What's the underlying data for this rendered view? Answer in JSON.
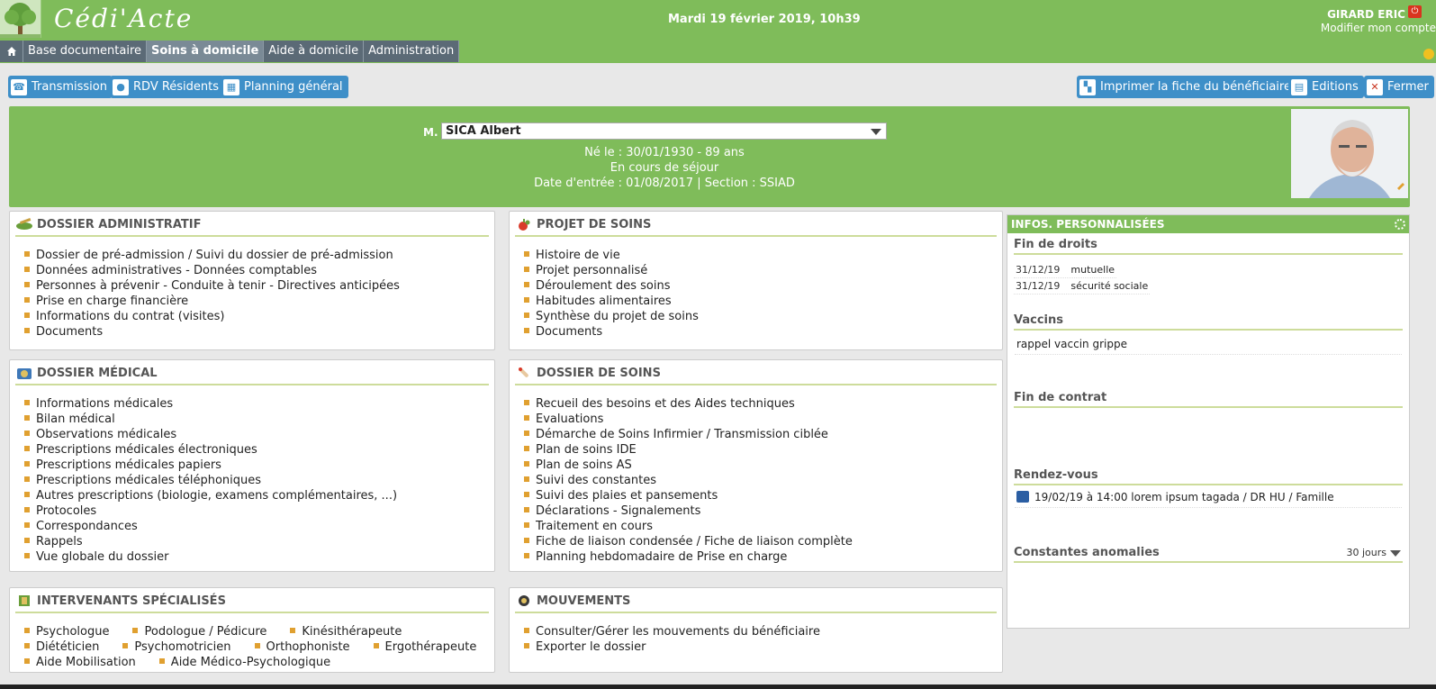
{
  "header": {
    "app_title": "Cédi'Acte",
    "date": "Mardi 19 février 2019, 10h39",
    "user_name": "GIRARD ERIC",
    "account_link": "Modifier mon compte"
  },
  "nav": {
    "tabs": [
      {
        "label": "Base documentaire"
      },
      {
        "label": "Soins à domicile",
        "active": true
      },
      {
        "label": "Aide à domicile"
      },
      {
        "label": "Administration"
      }
    ]
  },
  "toolbar": {
    "transmission": "Transmission",
    "rdv": "RDV Résidents",
    "planning": "Planning général",
    "print": "Imprimer la fiche du bénéficiaire",
    "editions": "Editions",
    "close": "Fermer"
  },
  "patient": {
    "civility": "M.",
    "name": "SICA Albert",
    "birth": "Né le : 30/01/1930 - 89 ans",
    "status": "En cours de séjour",
    "entry": "Date d'entrée : 01/08/2017 | Section : SSIAD"
  },
  "panels": {
    "admin": {
      "title": "DOSSIER ADMINISTRATIF",
      "items": [
        "Dossier de pré-admission / Suivi du dossier de pré-admission",
        "Données administratives - Données comptables",
        "Personnes à prévenir - Conduite à tenir - Directives anticipées",
        "Prise en charge financière",
        "Informations du contrat (visites)",
        "Documents"
      ]
    },
    "projet": {
      "title": "PROJET DE SOINS",
      "items": [
        "Histoire de vie",
        "Projet personnalisé",
        "Déroulement des soins",
        "Habitudes alimentaires",
        "Synthèse du projet de soins",
        "Documents"
      ]
    },
    "medical": {
      "title": "DOSSIER MÉDICAL",
      "items": [
        "Informations médicales",
        "Bilan médical",
        "Observations médicales",
        "Prescriptions médicales électroniques",
        "Prescriptions médicales papiers",
        "Prescriptions médicales téléphoniques",
        "Autres prescriptions (biologie, examens complémentaires, ...)",
        "Protocoles",
        "Correspondances",
        "Rappels",
        "Vue globale du dossier"
      ]
    },
    "soins": {
      "title": "DOSSIER DE SOINS",
      "items": [
        "Recueil des besoins et des Aides techniques",
        "Evaluations",
        "Démarche de Soins Infirmier / Transmission ciblée",
        "Plan de soins IDE",
        "Plan de soins AS",
        "Suivi des constantes",
        "Suivi des plaies et pansements",
        "Déclarations - Signalements",
        "Traitement en cours",
        "Fiche de liaison condensée / Fiche de liaison complète",
        "Planning hebdomadaire de Prise en charge"
      ]
    },
    "intervenants": {
      "title": "INTERVENANTS SPÉCIALISÉS",
      "items": [
        "Psychologue",
        "Podologue / Pédicure",
        "Kinésithérapeute",
        "Diététicien",
        "Psychomotricien",
        "Orthophoniste",
        "Ergothérapeute",
        "Aide Mobilisation",
        "Aide Médico-Psychologique"
      ]
    },
    "mouvements": {
      "title": "MOUVEMENTS",
      "items": [
        "Consulter/Gérer les mouvements du bénéficiaire",
        "Exporter le dossier"
      ]
    }
  },
  "infos": {
    "title": "INFOS. PERSONNALISÉES",
    "fin_droits": {
      "title": "Fin de droits",
      "rows": [
        {
          "date": "31/12/19",
          "label": "mutuelle"
        },
        {
          "date": "31/12/19",
          "label": "sécurité sociale"
        }
      ]
    },
    "vaccins": {
      "title": "Vaccins",
      "text": "rappel vaccin grippe"
    },
    "fin_contrat": {
      "title": "Fin de contrat"
    },
    "rdv": {
      "title": "Rendez-vous",
      "text": "19/02/19 à 14:00 lorem ipsum tagada / DR HU / Famille"
    },
    "constantes": {
      "title": "Constantes anomalies",
      "period": "30 jours"
    }
  }
}
